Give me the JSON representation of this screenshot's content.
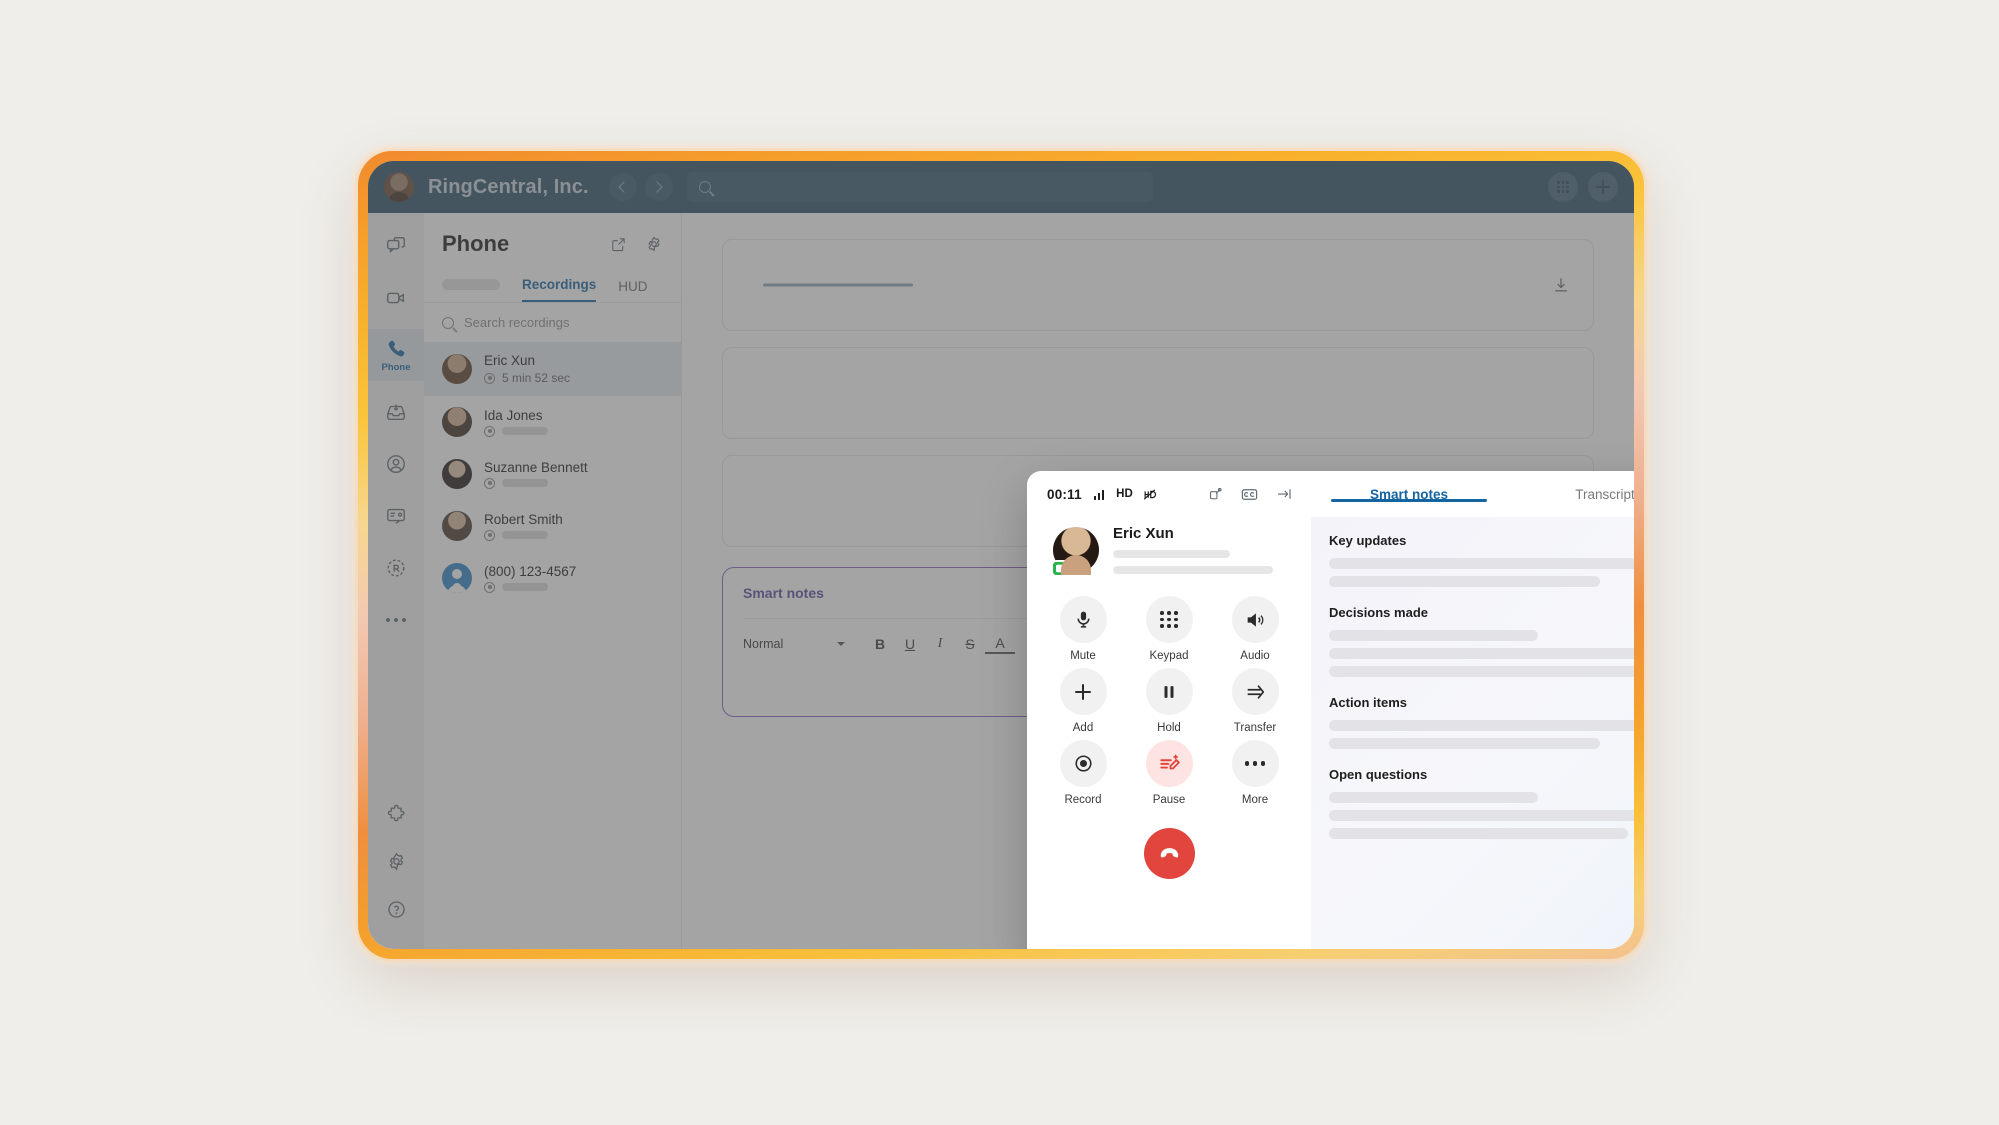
{
  "titlebar": {
    "account_name": "RingCentral, Inc.",
    "search_placeholder": "",
    "back_icon": "chevron-left-icon",
    "forward_icon": "chevron-right-icon",
    "search_icon": "search-icon",
    "dialpad_icon": "dialpad-icon",
    "add_icon": "plus-icon"
  },
  "rail": {
    "items": [
      {
        "name": "message",
        "icon": "message-bubbles-icon",
        "label": ""
      },
      {
        "name": "video",
        "icon": "video-camera-icon",
        "label": ""
      },
      {
        "name": "phone",
        "icon": "phone-handset-icon",
        "label": "Phone"
      },
      {
        "name": "fax",
        "icon": "inbox-download-icon",
        "label": ""
      },
      {
        "name": "contacts",
        "icon": "person-circle-icon",
        "label": ""
      },
      {
        "name": "analytics",
        "icon": "id-card-icon",
        "label": ""
      },
      {
        "name": "ringcentral-app",
        "icon": "ringcentral-r-icon",
        "label": ""
      },
      {
        "name": "more",
        "icon": "ellipsis-icon",
        "label": ""
      }
    ],
    "bottom_items": [
      {
        "name": "apps",
        "icon": "puzzle-piece-icon"
      },
      {
        "name": "settings",
        "icon": "gear-icon"
      },
      {
        "name": "help",
        "icon": "question-circle-icon"
      }
    ]
  },
  "phone_panel": {
    "title": "Phone",
    "popout_icon": "external-link-icon",
    "settings_icon": "gear-icon",
    "tabs": [
      {
        "label": "",
        "active": false,
        "skeleton": true
      },
      {
        "label": "Recordings",
        "active": true,
        "skeleton": false
      },
      {
        "label": "HUD",
        "active": false,
        "skeleton": false
      }
    ],
    "search_placeholder": "Search recordings",
    "search_icon": "search-icon",
    "recordings": [
      {
        "name": "Eric Xun",
        "duration": "5 min 52 sec",
        "selected": true,
        "avatar": "av-eric",
        "has_duration": true
      },
      {
        "name": "Ida Jones",
        "duration": "",
        "selected": false,
        "avatar": "av-ida",
        "has_duration": false
      },
      {
        "name": "Suzanne Bennett",
        "duration": "",
        "selected": false,
        "avatar": "av-suz",
        "has_duration": false
      },
      {
        "name": "Robert Smith",
        "duration": "",
        "selected": false,
        "avatar": "av-rob",
        "has_duration": false
      },
      {
        "name": "(800) 123-4567",
        "duration": "",
        "selected": false,
        "avatar": "av-generic",
        "has_duration": false
      }
    ]
  },
  "main_content": {
    "download_icon": "download-icon",
    "open_icon": "arrow-up-right-icon",
    "notes_card": {
      "title": "Smart notes",
      "icons": [
        {
          "name": "feedback-icon",
          "glyph": "comment-alert-icon"
        },
        {
          "name": "save-icon",
          "glyph": "floppy-disk-icon"
        },
        {
          "name": "delete-icon",
          "glyph": "trash-icon"
        },
        {
          "name": "share-icon",
          "glyph": "share-upload-icon"
        }
      ],
      "toolbar": {
        "style_select": "Normal",
        "buttons": [
          {
            "name": "bold",
            "glyph": "B"
          },
          {
            "name": "underline",
            "glyph": "U"
          },
          {
            "name": "italic",
            "glyph": "I"
          },
          {
            "name": "strikethrough",
            "glyph": "S"
          },
          {
            "name": "text-color",
            "glyph": "A"
          },
          {
            "name": "ordered-list",
            "glyph": "ordered-list-icon"
          },
          {
            "name": "bulleted-list",
            "glyph": "bulleted-list-icon"
          },
          {
            "name": "indent",
            "glyph": "indent-icon"
          },
          {
            "name": "outdent",
            "glyph": "outdent-icon"
          },
          {
            "name": "align",
            "glyph": "align-icon"
          }
        ]
      }
    }
  },
  "call_overlay": {
    "timer": "00:11",
    "quality_icon": "signal-bars-icon",
    "hd_label": "HD",
    "hd_off_icon": "hd-off-icon",
    "top_icons": [
      {
        "name": "popout-icon",
        "glyph": "external-window-icon"
      },
      {
        "name": "closed-caption-icon",
        "glyph": "cc-icon"
      },
      {
        "name": "collapse-panel-icon",
        "glyph": "arrow-to-right-icon"
      }
    ],
    "callee_name": "Eric Xun",
    "video_badge_icon": "video-camera-icon",
    "controls": [
      {
        "label": "Mute",
        "icon": "microphone-icon",
        "accent": false
      },
      {
        "label": "Keypad",
        "icon": "dialpad-icon",
        "accent": false
      },
      {
        "label": "Audio",
        "icon": "speaker-icon",
        "accent": false
      },
      {
        "label": "Add",
        "icon": "plus-icon",
        "accent": false
      },
      {
        "label": "Hold",
        "icon": "pause-icon",
        "accent": false
      },
      {
        "label": "Transfer",
        "icon": "transfer-arrow-icon",
        "accent": false
      },
      {
        "label": "Record",
        "icon": "record-circle-icon",
        "accent": false
      },
      {
        "label": "Pause",
        "icon": "smart-notes-pencil-icon",
        "accent": true
      },
      {
        "label": "More",
        "icon": "ellipsis-icon",
        "accent": false
      }
    ],
    "end_call_icon": "hangup-phone-icon",
    "tabs": [
      {
        "label": "Smart notes",
        "active": true
      },
      {
        "label": "Transcript",
        "active": false
      }
    ],
    "notes_sections": [
      {
        "heading": "Key updates",
        "line_widths": [
          100,
          78
        ]
      },
      {
        "heading": "Decisions made",
        "line_widths": [
          60,
          100,
          89
        ]
      },
      {
        "heading": "Action items",
        "line_widths": [
          100,
          78
        ]
      },
      {
        "heading": "Open questions",
        "line_widths": [
          60,
          98,
          86
        ]
      }
    ]
  },
  "colors": {
    "titlebar_bg": "#2a5068",
    "accent_blue": "#1565a0",
    "end_call_red": "#e1453d",
    "accent_pink_bg": "#fde4e2",
    "notes_purple": "#8b5fbf",
    "frame_orange": "#f08a2e",
    "frame_yellow": "#fac53b"
  }
}
